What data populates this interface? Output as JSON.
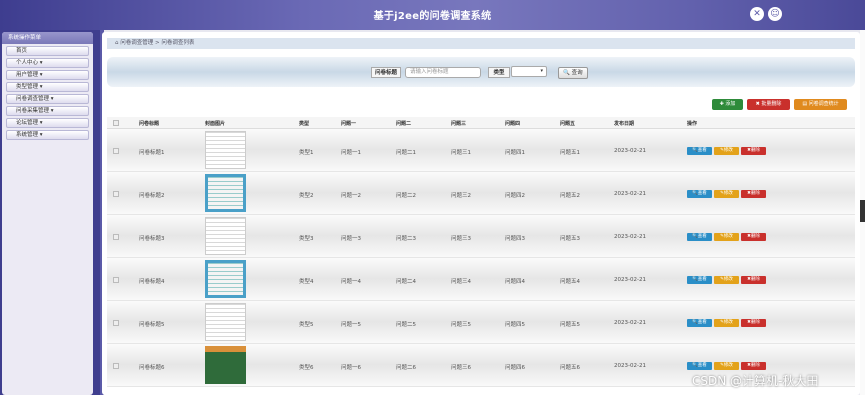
{
  "app": {
    "title": "基于j2ee的问卷调查系统"
  },
  "header_icons": [
    "close-icon",
    "user-icon"
  ],
  "sidebar": {
    "heading": "系统操作菜单",
    "items": [
      "首页",
      "个人中心 ▾",
      "用户管理 ▾",
      "类型管理 ▾",
      "问卷调查管理 ▾",
      "问卷采集管理 ▾",
      "论坛管理 ▾",
      "系统管理 ▾"
    ]
  },
  "breadcrumb": "问卷调查管理 > 问卷调查列表",
  "search": {
    "title_label": "问卷标题",
    "title_placeholder": "请输入问卷标题",
    "type_label": "类型",
    "query_button": "查询"
  },
  "actions": {
    "add": "添加",
    "batch_delete": "批量删除",
    "stats": "问卷调查统计"
  },
  "table": {
    "headers": [
      "问卷标题",
      "封面图片",
      "类型",
      "问题一",
      "问题二",
      "问题三",
      "问题四",
      "问题五",
      "发布日期",
      "操作"
    ],
    "rows": [
      {
        "title": "问卷标题1",
        "type": "类型1",
        "q1": "问题一1",
        "q2": "问题二1",
        "q3": "问题三1",
        "q4": "问题四1",
        "q5": "问题五1",
        "date": "2023-02-21"
      },
      {
        "title": "问卷标题2",
        "type": "类型2",
        "q1": "问题一2",
        "q2": "问题二2",
        "q3": "问题三2",
        "q4": "问题四2",
        "q5": "问题五2",
        "date": "2023-02-21"
      },
      {
        "title": "问卷标题3",
        "type": "类型3",
        "q1": "问题一3",
        "q2": "问题二3",
        "q3": "问题三3",
        "q4": "问题四3",
        "q5": "问题五3",
        "date": "2023-02-21"
      },
      {
        "title": "问卷标题4",
        "type": "类型4",
        "q1": "问题一4",
        "q2": "问题二4",
        "q3": "问题三4",
        "q4": "问题四4",
        "q5": "问题五4",
        "date": "2023-02-21"
      },
      {
        "title": "问卷标题5",
        "type": "类型5",
        "q1": "问题一5",
        "q2": "问题二5",
        "q3": "问题三5",
        "q4": "问题四5",
        "q5": "问题五5",
        "date": "2023-02-21"
      },
      {
        "title": "问卷标题6",
        "type": "类型6",
        "q1": "问题一6",
        "q2": "问题二6",
        "q3": "问题三6",
        "q4": "问题四6",
        "q5": "问题五6",
        "date": "2023-02-21"
      }
    ],
    "row_buttons": {
      "view": "查看",
      "edit": "修改",
      "delete": "删除"
    }
  },
  "watermark": "CSDN @计算机-秋大田",
  "colors": {
    "header": "#6261ad",
    "add": "#2e8b3a",
    "delete": "#c9302c",
    "stats": "#e08a1e",
    "view": "#2a8ec7",
    "edit": "#e3a21a"
  }
}
